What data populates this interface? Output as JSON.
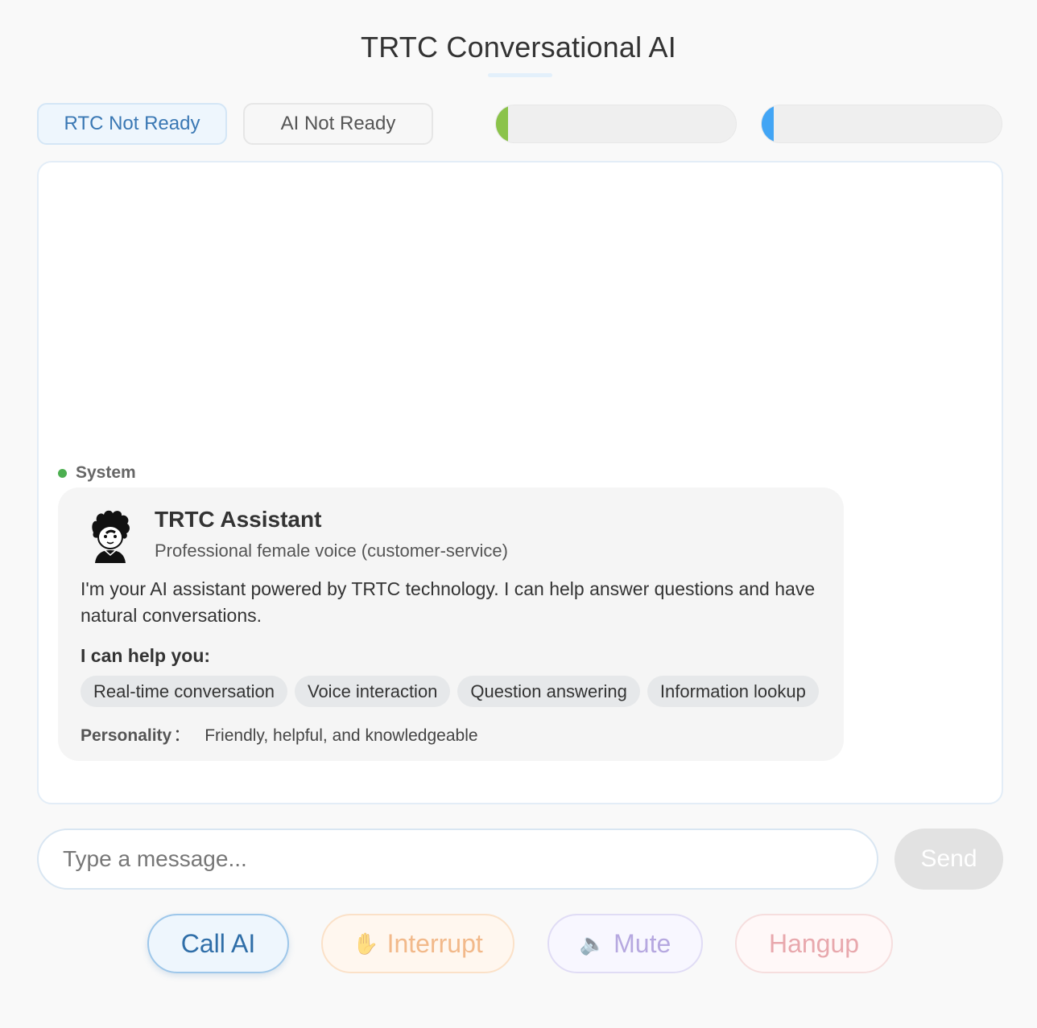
{
  "header": {
    "title": "TRTC Conversational AI"
  },
  "status": {
    "rtc_label": "RTC Not Ready",
    "ai_label": "AI Not Ready",
    "user_meter": {
      "level": 0.05,
      "color": "#8bc34a"
    },
    "ai_meter": {
      "level": 0.05,
      "color": "#42a5f5"
    }
  },
  "chat": {
    "messages": [
      {
        "sender": "System",
        "sender_dot_color": "#4caf50",
        "card": {
          "avatar_icon": "cartoon-boy-avatar-icon",
          "name": "TRTC Assistant",
          "voice": "Professional female voice (customer-service)",
          "intro": "I'm your AI assistant powered by TRTC technology. I can help answer questions and have natural conversations.",
          "help_heading": "I can help you:",
          "capabilities": [
            "Real-time conversation",
            "Voice interaction",
            "Question answering",
            "Information lookup"
          ],
          "personality_label": "Personality",
          "personality_sep": "：",
          "personality_value": "Friendly, helpful, and knowledgeable"
        }
      }
    ]
  },
  "composer": {
    "placeholder": "Type a message...",
    "value": "",
    "send_label": "Send"
  },
  "controls": {
    "call_label": "Call AI",
    "interrupt_icon": "raised-hand-icon",
    "interrupt_glyph": "✋",
    "interrupt_label": "Interrupt",
    "mute_icon": "speaker-icon",
    "mute_glyph": "🔈",
    "mute_label": "Mute",
    "hangup_label": "Hangup"
  },
  "colors": {
    "accent": "#3a78b4",
    "interrupt": "#f2b98a",
    "mute": "#b6a8e0",
    "hangup": "#e8a8ad"
  }
}
